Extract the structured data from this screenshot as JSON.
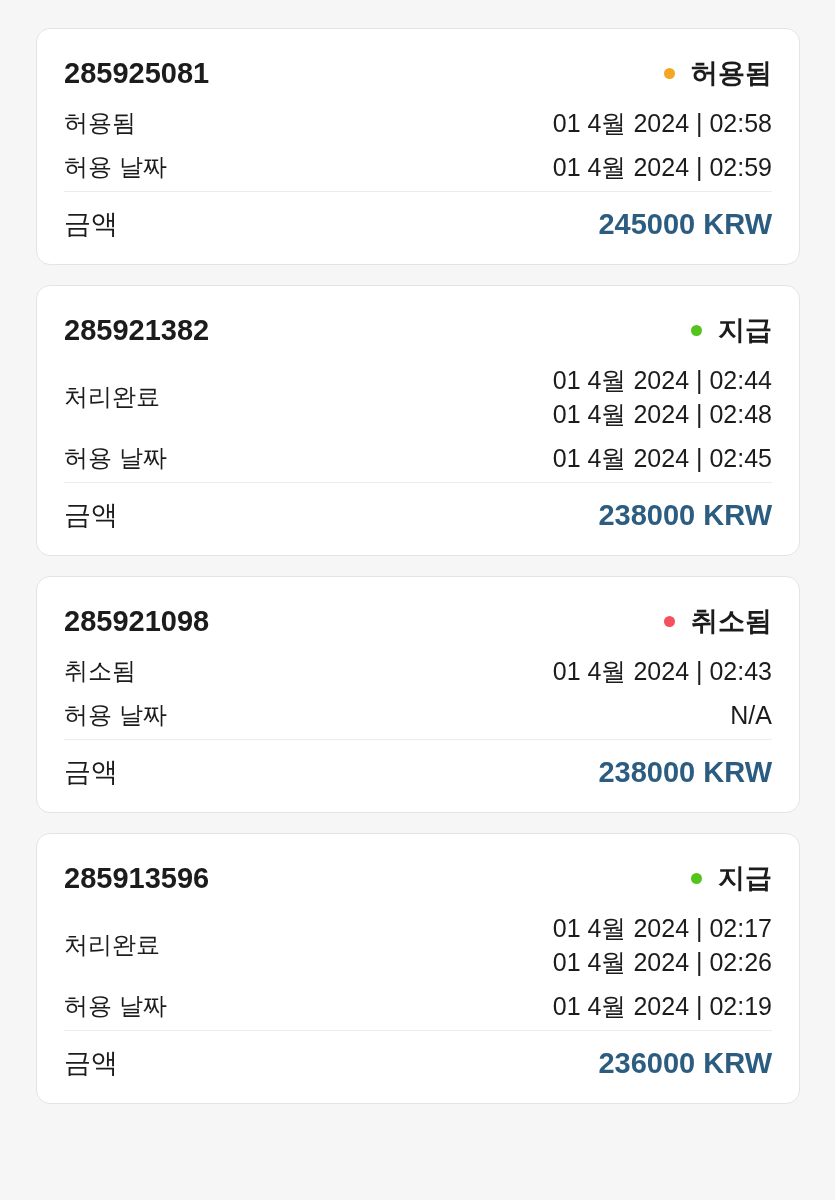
{
  "cards": [
    {
      "order_number": "285925081",
      "status": {
        "label": "허용됨",
        "color": "#f5a623"
      },
      "rows": [
        {
          "label": "허용됨",
          "values": [
            "01 4월 2024 | 02:58"
          ]
        },
        {
          "label": "허용 날짜",
          "values": [
            "01 4월 2024 | 02:59"
          ]
        }
      ],
      "amount_label": "금액",
      "amount": "245000 KRW"
    },
    {
      "order_number": "285921382",
      "status": {
        "label": "지급",
        "color": "#52c41a"
      },
      "rows": [
        {
          "label": "처리완료",
          "values": [
            "01 4월 2024 | 02:44",
            "01 4월 2024 | 02:48"
          ]
        },
        {
          "label": "허용 날짜",
          "values": [
            "01 4월 2024 | 02:45"
          ]
        }
      ],
      "amount_label": "금액",
      "amount": "238000 KRW"
    },
    {
      "order_number": "285921098",
      "status": {
        "label": "취소됨",
        "color": "#f4515c"
      },
      "rows": [
        {
          "label": "취소됨",
          "values": [
            "01 4월 2024 | 02:43"
          ]
        },
        {
          "label": "허용 날짜",
          "values": [
            "N/A"
          ]
        }
      ],
      "amount_label": "금액",
      "amount": "238000 KRW"
    },
    {
      "order_number": "285913596",
      "status": {
        "label": "지급",
        "color": "#52c41a"
      },
      "rows": [
        {
          "label": "처리완료",
          "values": [
            "01 4월 2024 | 02:17",
            "01 4월 2024 | 02:26"
          ]
        },
        {
          "label": "허용 날짜",
          "values": [
            "01 4월 2024 | 02:19"
          ]
        }
      ],
      "amount_label": "금액",
      "amount": "236000 KRW"
    }
  ]
}
